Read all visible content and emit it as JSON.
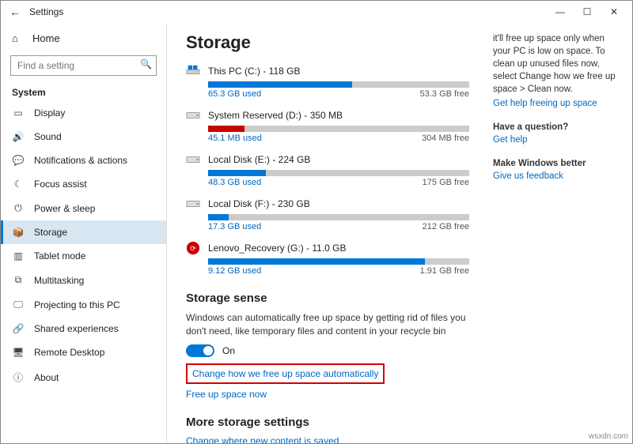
{
  "window": {
    "app_title": "Settings",
    "back_icon": "←"
  },
  "sidebar": {
    "home": "Home",
    "search_placeholder": "Find a setting",
    "section": "System",
    "items": [
      {
        "icon": "▭",
        "label": "Display"
      },
      {
        "icon": "🔊",
        "label": "Sound"
      },
      {
        "icon": "💬",
        "label": "Notifications & actions"
      },
      {
        "icon": "☾",
        "label": "Focus assist"
      },
      {
        "icon": "⏻",
        "label": "Power & sleep"
      },
      {
        "icon": "📦",
        "label": "Storage"
      },
      {
        "icon": "▥",
        "label": "Tablet mode"
      },
      {
        "icon": "⧉",
        "label": "Multitasking"
      },
      {
        "icon": "🖵",
        "label": "Projecting to this PC"
      },
      {
        "icon": "🔗",
        "label": "Shared experiences"
      },
      {
        "icon": "🖥",
        "label": "Remote Desktop"
      },
      {
        "icon": "ⓘ",
        "label": "About"
      }
    ]
  },
  "page": {
    "title": "Storage",
    "drives": [
      {
        "name": "This PC (C:) - 118 GB",
        "used": "65.3 GB used",
        "free": "53.3 GB free",
        "pct": 55,
        "color": "blue",
        "type": "win"
      },
      {
        "name": "System Reserved (D:) - 350 MB",
        "used": "45.1 MB used",
        "free": "304 MB free",
        "pct": 14,
        "color": "red",
        "type": "hdd"
      },
      {
        "name": "Local Disk (E:) - 224 GB",
        "used": "48.3 GB used",
        "free": "175 GB free",
        "pct": 22,
        "color": "blue",
        "type": "hdd"
      },
      {
        "name": "Local Disk (F:) - 230 GB",
        "used": "17.3 GB used",
        "free": "212 GB free",
        "pct": 8,
        "color": "blue",
        "type": "hdd"
      },
      {
        "name": "Lenovo_Recovery (G:) - 11.0 GB",
        "used": "9.12 GB used",
        "free": "1.91 GB free",
        "pct": 83,
        "color": "blue",
        "type": "recovery"
      }
    ],
    "sense_head": "Storage sense",
    "sense_desc": "Windows can automatically free up space by getting rid of files you don't need, like temporary files and content in your recycle bin",
    "sense_on": "On",
    "link_change": "Change how we free up space automatically",
    "link_freeup": "Free up space now",
    "more_head": "More storage settings",
    "link_where": "Change where new content is saved"
  },
  "rightcol": {
    "tip": "it'll free up space only when your PC is low on space. To clean up unused files now, select Change how we free up space > Clean now.",
    "tip_link": "Get help freeing up space",
    "q_head": "Have a question?",
    "q_link": "Get help",
    "fb_head": "Make Windows better",
    "fb_link": "Give us feedback"
  },
  "watermark": "wsxdn.com"
}
